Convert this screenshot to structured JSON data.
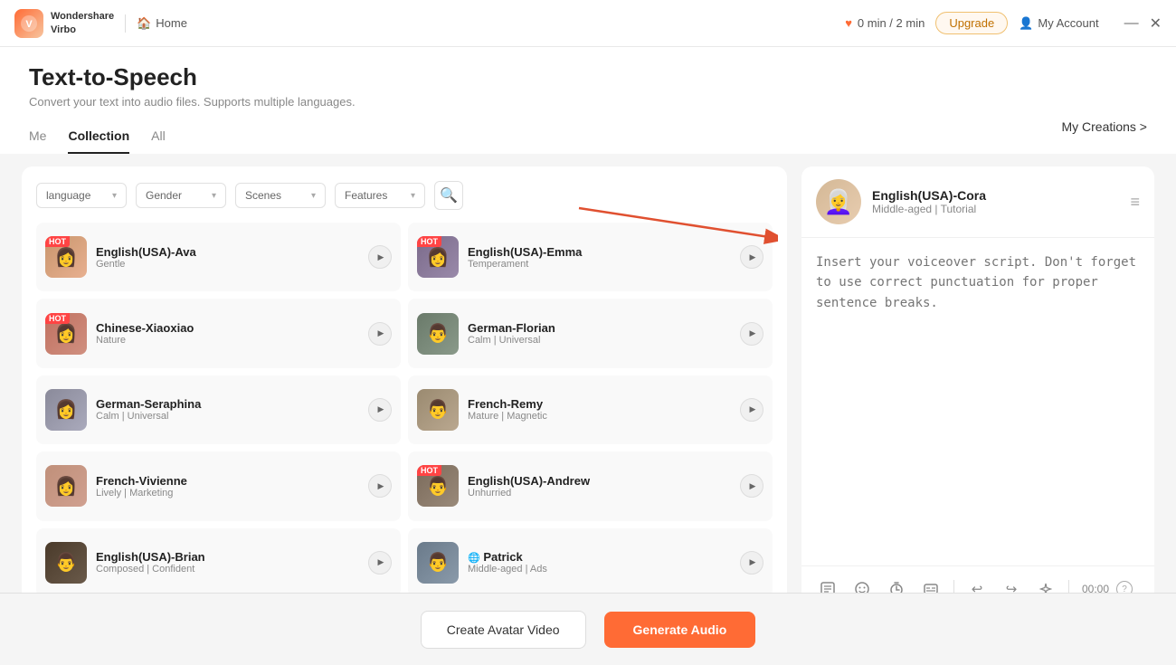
{
  "app": {
    "logo_text": "Wondershare\nVirbo",
    "logo_initials": "V"
  },
  "titlebar": {
    "home_label": "Home",
    "time_label": "0 min / 2 min",
    "upgrade_label": "Upgrade",
    "account_label": "My Account",
    "minimize": "—",
    "close": "✕"
  },
  "page": {
    "title": "Text-to-Speech",
    "subtitle": "Convert your text into audio files. Supports multiple languages.",
    "my_creations_label": "My Creations >"
  },
  "tabs": [
    {
      "id": "me",
      "label": "Me"
    },
    {
      "id": "collection",
      "label": "Collection"
    },
    {
      "id": "all",
      "label": "All"
    }
  ],
  "filters": {
    "language_placeholder": "language",
    "gender_placeholder": "Gender",
    "scenes_placeholder": "Scenes",
    "features_placeholder": "Features"
  },
  "voices": [
    {
      "id": "ava",
      "name": "English(USA)-Ava",
      "tags": "Gentle",
      "hot": true,
      "avatar_class": "av-ava",
      "emoji": "👩"
    },
    {
      "id": "emma",
      "name": "English(USA)-Emma",
      "tags": "Temperament",
      "hot": true,
      "avatar_class": "av-emma",
      "emoji": "👩"
    },
    {
      "id": "xiaoxiao",
      "name": "Chinese-Xiaoxiao",
      "tags": "Nature",
      "hot": false,
      "avatar_class": "av-xiaoxiao",
      "emoji": "👩"
    },
    {
      "id": "florian",
      "name": "German-Florian",
      "tags": "Calm | Universal",
      "hot": false,
      "avatar_class": "av-florian",
      "emoji": "👨"
    },
    {
      "id": "seraphina",
      "name": "German-Seraphina",
      "tags": "Calm | Universal",
      "hot": false,
      "avatar_class": "av-seraphina",
      "emoji": "👩"
    },
    {
      "id": "remy",
      "name": "French-Remy",
      "tags": "Mature | Magnetic",
      "hot": false,
      "avatar_class": "av-remy",
      "emoji": "👨"
    },
    {
      "id": "vivienne",
      "name": "French-Vivienne",
      "tags": "Lively | Marketing",
      "hot": false,
      "avatar_class": "av-vivienne",
      "emoji": "👩"
    },
    {
      "id": "andrew",
      "name": "English(USA)-Andrew",
      "tags": "Unhurried",
      "hot": true,
      "avatar_class": "av-andrew",
      "emoji": "👨"
    },
    {
      "id": "brian",
      "name": "English(USA)-Brian",
      "tags": "Composed | Confident",
      "hot": false,
      "avatar_class": "av-brian",
      "emoji": "👨"
    },
    {
      "id": "patrick",
      "name": "Patrick",
      "tags": "Middle-aged | Ads",
      "hot": false,
      "globe": true,
      "avatar_class": "av-patrick",
      "emoji": "👨"
    }
  ],
  "selected_voice": {
    "name": "English(USA)-Cora",
    "tags": "Middle-aged | Tutorial",
    "placeholder_text": "Insert your voiceover script. Don't forget to use correct punctuation for proper sentence breaks.",
    "avatar_class": "av-cora",
    "emoji": "👩‍🦳"
  },
  "toolbar": {
    "time": "00:00",
    "icons": [
      "⊞",
      "☺",
      "⏱",
      "⊡"
    ],
    "undo": "↩",
    "redo": "↪",
    "magic": "✦"
  },
  "bottom": {
    "create_avatar_label": "Create Avatar Video",
    "generate_label": "Generate Audio"
  },
  "colors": {
    "accent": "#ff6b35",
    "hot_badge": "#ff4444"
  }
}
